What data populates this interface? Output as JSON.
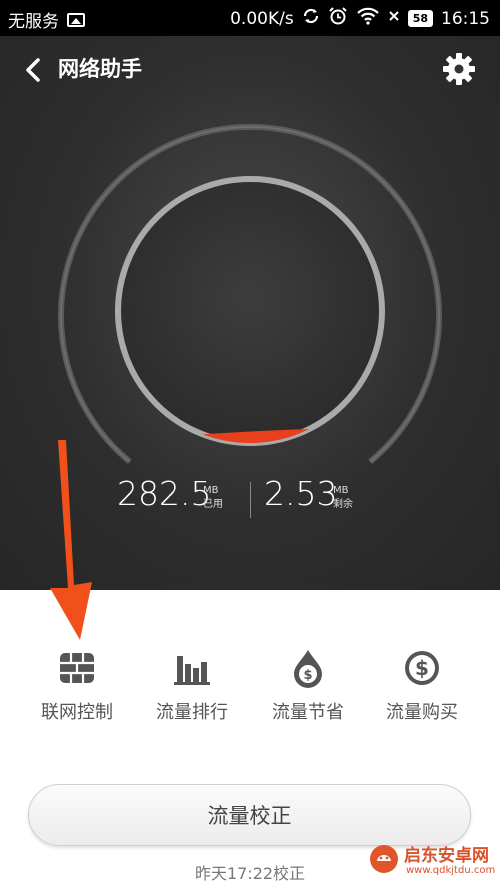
{
  "status_bar": {
    "carrier": "无服务",
    "speed": "0.00K/s",
    "battery": "58",
    "time": "16:15"
  },
  "header": {
    "title": "网络助手"
  },
  "gauge": {
    "used_value": "282.5",
    "used_unit": "MB",
    "used_label": "已用",
    "remaining_value": "2.53",
    "remaining_unit": "MB",
    "remaining_label": "剩余",
    "accent_color": "#e8401c"
  },
  "actions": [
    {
      "label": "联网控制",
      "icon": "firewall-icon"
    },
    {
      "label": "流量排行",
      "icon": "bar-chart-icon"
    },
    {
      "label": "流量节省",
      "icon": "money-drop-icon"
    },
    {
      "label": "流量购买",
      "icon": "dollar-coin-icon"
    }
  ],
  "calibrate": {
    "button_label": "流量校正",
    "last_time": "昨天17:22校正"
  },
  "watermark": {
    "name": "启东安卓网",
    "url": "www.qdkjtdu.com"
  }
}
